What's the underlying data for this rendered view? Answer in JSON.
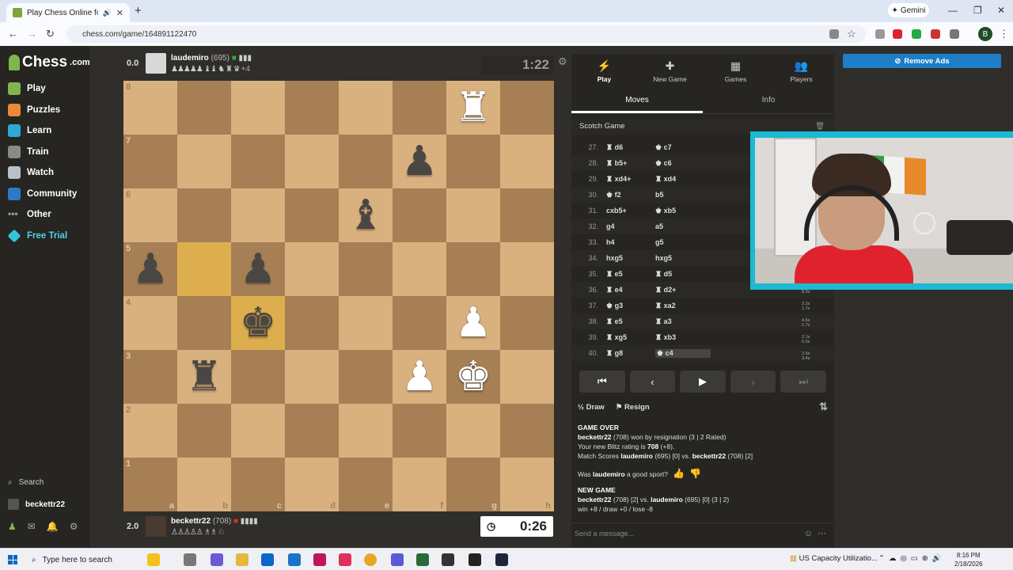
{
  "browser": {
    "tab_title": "Play Chess Online for FREE",
    "new_tab": "+",
    "gemini_label": "Gemini",
    "url": "chess.com/game/164891122470",
    "profile_initial": "B"
  },
  "sidebar": {
    "logo": "Chess",
    "logo_suffix": ".com",
    "items": [
      {
        "label": "Play",
        "color": "#81b64c"
      },
      {
        "label": "Puzzles",
        "color": "#e9893a"
      },
      {
        "label": "Learn",
        "color": "#2fa8d8"
      },
      {
        "label": "Train",
        "color": "#8a8a8a"
      },
      {
        "label": "Watch",
        "color": "#b8c0c8"
      },
      {
        "label": "Community",
        "color": "#2f78c8"
      },
      {
        "label": "Other",
        "color": "#9a9a9a"
      },
      {
        "label": "Free Trial",
        "color": "#2fc7d8"
      }
    ],
    "search_label": "Search",
    "username": "beckettr22"
  },
  "top_player": {
    "score": "0.0",
    "name": "laudemiro",
    "rating": "(695)",
    "captured": "♟♟♟♟♟ ♝♝ ♞ ♜ ♛",
    "advantage": "+4",
    "clock": "1:22"
  },
  "bottom_player": {
    "score": "2.0",
    "name": "beckettr22",
    "rating": "(708)",
    "captured": "♙♙♙♙♙ ♗♗ ♘",
    "clock": "0:26"
  },
  "board": {
    "ranks": [
      "8",
      "7",
      "6",
      "5",
      "4",
      "3",
      "2",
      "1"
    ],
    "files": [
      "a",
      "b",
      "c",
      "d",
      "e",
      "f",
      "g",
      "h"
    ],
    "pieces": {
      "g8": {
        "glyph": "♜",
        "side": "w"
      },
      "f7": {
        "glyph": "♟",
        "side": "b"
      },
      "e6": {
        "glyph": "♝",
        "side": "b"
      },
      "a5": {
        "glyph": "♟",
        "side": "b"
      },
      "c5": {
        "glyph": "♟",
        "side": "b"
      },
      "c4": {
        "glyph": "♚",
        "side": "b"
      },
      "g4": {
        "glyph": "♟",
        "side": "w"
      },
      "b3": {
        "glyph": "♜",
        "side": "b"
      },
      "f3": {
        "glyph": "♟",
        "side": "w"
      },
      "g3": {
        "glyph": "♚",
        "side": "w"
      }
    },
    "highlights": [
      "b5",
      "c4"
    ]
  },
  "panel": {
    "tabs": [
      {
        "label": "Play",
        "icon": "⚡"
      },
      {
        "label": "New Game",
        "icon": "✚"
      },
      {
        "label": "Games",
        "icon": "▦"
      },
      {
        "label": "Players",
        "icon": "👥"
      }
    ],
    "subtabs": [
      "Moves",
      "Info"
    ],
    "opening": "Scotch Game",
    "moves": [
      {
        "n": "27.",
        "w": "♜ d6",
        "b": "♚ c7"
      },
      {
        "n": "28.",
        "w": "♜ b5+",
        "b": "♚ c6"
      },
      {
        "n": "29.",
        "w": "♜ xd4+",
        "b": "♜ xd4"
      },
      {
        "n": "30.",
        "w": "♚ f2",
        "b": "b5"
      },
      {
        "n": "31.",
        "w": "cxb5+",
        "b": "♚ xb5"
      },
      {
        "n": "32.",
        "w": "g4",
        "b": "a5"
      },
      {
        "n": "33.",
        "w": "h4",
        "b": "g5"
      },
      {
        "n": "34.",
        "w": "hxg5",
        "b": "hxg5"
      },
      {
        "n": "35.",
        "w": "♜ e5",
        "b": "♜ d5"
      },
      {
        "n": "36.",
        "w": "♜ e4",
        "b": "♜ d2+"
      },
      {
        "n": "37.",
        "w": "♚ g3",
        "b": "♜ xa2"
      },
      {
        "n": "38.",
        "w": "♜ e5",
        "b": "♜ a3"
      },
      {
        "n": "39.",
        "w": "♜ xg5",
        "b": "♜ xb3"
      },
      {
        "n": "40.",
        "w": "♜ g8",
        "b": "♚ c4"
      }
    ],
    "times": [
      {
        "a": "8.5s",
        "b": ""
      },
      {
        "a": "2.2s",
        "b": "1.7s"
      },
      {
        "a": "4.6s",
        "b": "1.7s"
      },
      {
        "a": "2.1s",
        "b": "0.5s"
      },
      {
        "a": "2.5s",
        "b": "3.4s"
      }
    ],
    "controls": [
      "⏮",
      "‹",
      "▶",
      "›",
      "⏭"
    ],
    "draw_label": "Draw",
    "resign_label": "Resign",
    "log": {
      "game_over": "GAME OVER",
      "result_name": "beckettr22",
      "result_text": " (708) won by resignation (3 | 2 Rated)",
      "rating_text_pre": "Your new Blitz rating is ",
      "rating_value": "708",
      "rating_change": " (+8).",
      "match_pre": "Match Scores ",
      "match_p1": "laudemiro",
      "match_mid": " (695) [0] vs. ",
      "match_p2": "beckettr22",
      "match_post": " (708) [2]",
      "sport_pre": "Was ",
      "sport_name": "laudemiro",
      "sport_post": " a good sport?",
      "new_game": "NEW GAME",
      "ng_p1": "beckettr22",
      "ng_mid": " (708) [2] vs. ",
      "ng_p2": "laudemiro",
      "ng_post": " (695) [0] (3 | 2)",
      "stakes": "win +8 / draw +0 / lose -8"
    },
    "chat_placeholder": "Send a message..."
  },
  "remove_ads": "Remove Ads",
  "taskbar": {
    "search_placeholder": "Type here to search",
    "tray_text": "US Capacity Utilizatio...",
    "time": "8:16 PM",
    "date": "2/18/2026"
  }
}
